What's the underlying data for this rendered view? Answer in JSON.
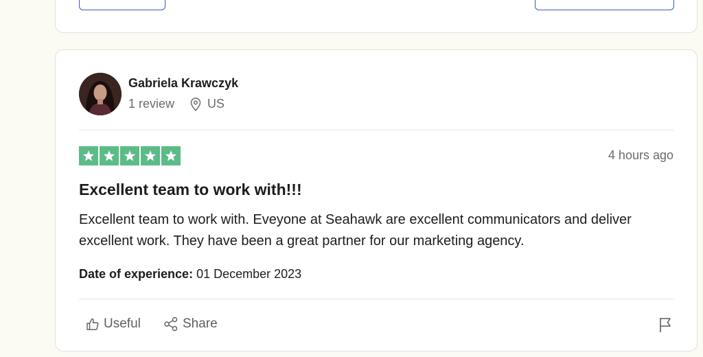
{
  "reviewer": {
    "name": "Gabriela Krawczyk",
    "review_count": "1 review",
    "country": "US"
  },
  "review": {
    "rating": 5,
    "time_ago": "4 hours ago",
    "title": "Excellent team to work with!!!",
    "body": "Excellent team to work with. Eveyone at Seahawk are excellent communicators and deliver excellent work. They have been a great partner for our marketing agency.",
    "date_label": "Date of experience:",
    "date_value": "01 December 2023"
  },
  "actions": {
    "useful_label": "Useful",
    "share_label": "Share"
  },
  "colors": {
    "star_green": "#5cbb87",
    "button_border": "#3c57bc"
  },
  "icons": [
    "location-pin-icon",
    "thumbs-up-icon",
    "share-icon",
    "flag-icon",
    "star-icon"
  ]
}
